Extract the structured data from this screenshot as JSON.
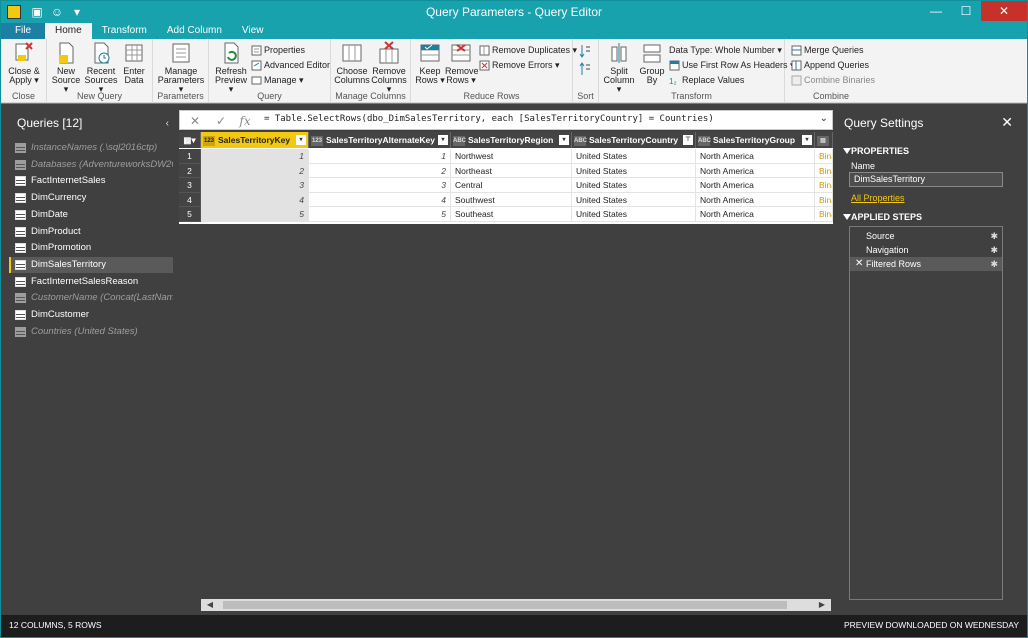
{
  "window": {
    "title": "Query Parameters - Query Editor",
    "controls": {
      "minimize": "—",
      "maximize": "☐",
      "close": "✕"
    }
  },
  "ribbon": {
    "tabs": [
      "File",
      "Home",
      "Transform",
      "Add Column",
      "View"
    ],
    "active_tab": "Home",
    "groups": {
      "close": {
        "label": "Close",
        "close_apply": [
          "Close &",
          "Apply ▾"
        ]
      },
      "new_query": {
        "label": "New Query",
        "new_source": [
          "New",
          "Source ▾"
        ],
        "recent_sources": [
          "Recent",
          "Sources ▾"
        ],
        "enter_data": [
          "Enter",
          "Data"
        ]
      },
      "parameters": {
        "label": "Parameters",
        "manage_parameters": [
          "Manage",
          "Parameters ▾"
        ]
      },
      "query": {
        "label": "Query",
        "refresh_preview": [
          "Refresh",
          "Preview ▾"
        ],
        "properties": "Properties",
        "advanced_editor": "Advanced Editor",
        "manage": "Manage ▾"
      },
      "manage_columns": {
        "label": "Manage Columns",
        "choose_columns": [
          "Choose",
          "Columns"
        ],
        "remove_columns": [
          "Remove",
          "Columns ▾"
        ]
      },
      "reduce_rows": {
        "label": "Reduce Rows",
        "keep_rows": [
          "Keep",
          "Rows ▾"
        ],
        "remove_rows": [
          "Remove",
          "Rows ▾"
        ],
        "remove_duplicates": "Remove Duplicates ▾",
        "remove_errors": "Remove Errors ▾"
      },
      "sort": {
        "label": "Sort"
      },
      "transform": {
        "label": "Transform",
        "split_column": [
          "Split",
          "Column ▾"
        ],
        "group_by": [
          "Group",
          "By"
        ],
        "data_type": "Data Type: Whole Number ▾",
        "first_row_headers": "Use First Row As Headers ▾",
        "replace_values": "Replace Values"
      },
      "combine": {
        "label": "Combine",
        "merge_queries": "Merge Queries",
        "append_queries": "Append Queries",
        "combine_binaries": "Combine Binaries"
      }
    }
  },
  "queries": {
    "header": "Queries [12]",
    "collapse": "‹",
    "items": [
      {
        "label": "InstanceNames (.\\sql2016ctp)",
        "disabled": true
      },
      {
        "label": "Databases (AdventureworksDW2016CTP3)",
        "disabled": true
      },
      {
        "label": "FactInternetSales",
        "disabled": false
      },
      {
        "label": "DimCurrency",
        "disabled": false
      },
      {
        "label": "DimDate",
        "disabled": false
      },
      {
        "label": "DimProduct",
        "disabled": false
      },
      {
        "label": "DimPromotion",
        "disabled": false
      },
      {
        "label": "DimSalesTerritory",
        "disabled": false,
        "selected": true
      },
      {
        "label": "FactInternetSalesReason",
        "disabled": false
      },
      {
        "label": "CustomerName (Concat(LastName, ', ', FirstName))",
        "disabled": true
      },
      {
        "label": "DimCustomer",
        "disabled": false
      },
      {
        "label": "Countries (United States)",
        "disabled": true
      }
    ]
  },
  "formula_bar": {
    "cancel": "✕",
    "commit": "✓",
    "fx": "fx",
    "formula": "= Table.SelectRows(dbo_DimSalesTerritory, each [SalesTerritoryCountry] = Countries)",
    "expand": "⌄"
  },
  "grid": {
    "columns": [
      {
        "name": "SalesTerritoryKey",
        "type": "123"
      },
      {
        "name": "SalesTerritoryAlternateKey",
        "type": "123"
      },
      {
        "name": "SalesTerritoryRegion",
        "type": "ABC"
      },
      {
        "name": "SalesTerritoryCountry",
        "type": "ABC"
      },
      {
        "name": "SalesTerritoryGroup",
        "type": "ABC"
      },
      {
        "name": "",
        "type": "▤"
      }
    ],
    "rows": [
      [
        "1",
        "1",
        "1",
        "Northwest",
        "United States",
        "North America",
        "Binary"
      ],
      [
        "2",
        "2",
        "2",
        "Northeast",
        "United States",
        "North America",
        "Binary"
      ],
      [
        "3",
        "3",
        "3",
        "Central",
        "United States",
        "North America",
        "Binary"
      ],
      [
        "4",
        "4",
        "4",
        "Southwest",
        "United States",
        "North America",
        "Binary"
      ],
      [
        "5",
        "5",
        "5",
        "Southeast",
        "United States",
        "North America",
        "Binary"
      ]
    ]
  },
  "settings": {
    "title": "Query Settings",
    "close": "✕",
    "properties_header": "PROPERTIES",
    "name_label": "Name",
    "name_value": "DimSalesTerritory",
    "all_properties": "All Properties",
    "steps_header": "APPLIED STEPS",
    "steps": [
      {
        "label": "Source",
        "selected": false
      },
      {
        "label": "Navigation",
        "selected": false
      },
      {
        "label": "Filtered Rows",
        "selected": true
      }
    ]
  },
  "status": {
    "left": "12 COLUMNS, 5 ROWS",
    "right": "PREVIEW DOWNLOADED ON WEDNESDAY"
  },
  "colors": {
    "accent": "#17a2ae",
    "highlight": "#f2c811",
    "panel": "#404040"
  }
}
